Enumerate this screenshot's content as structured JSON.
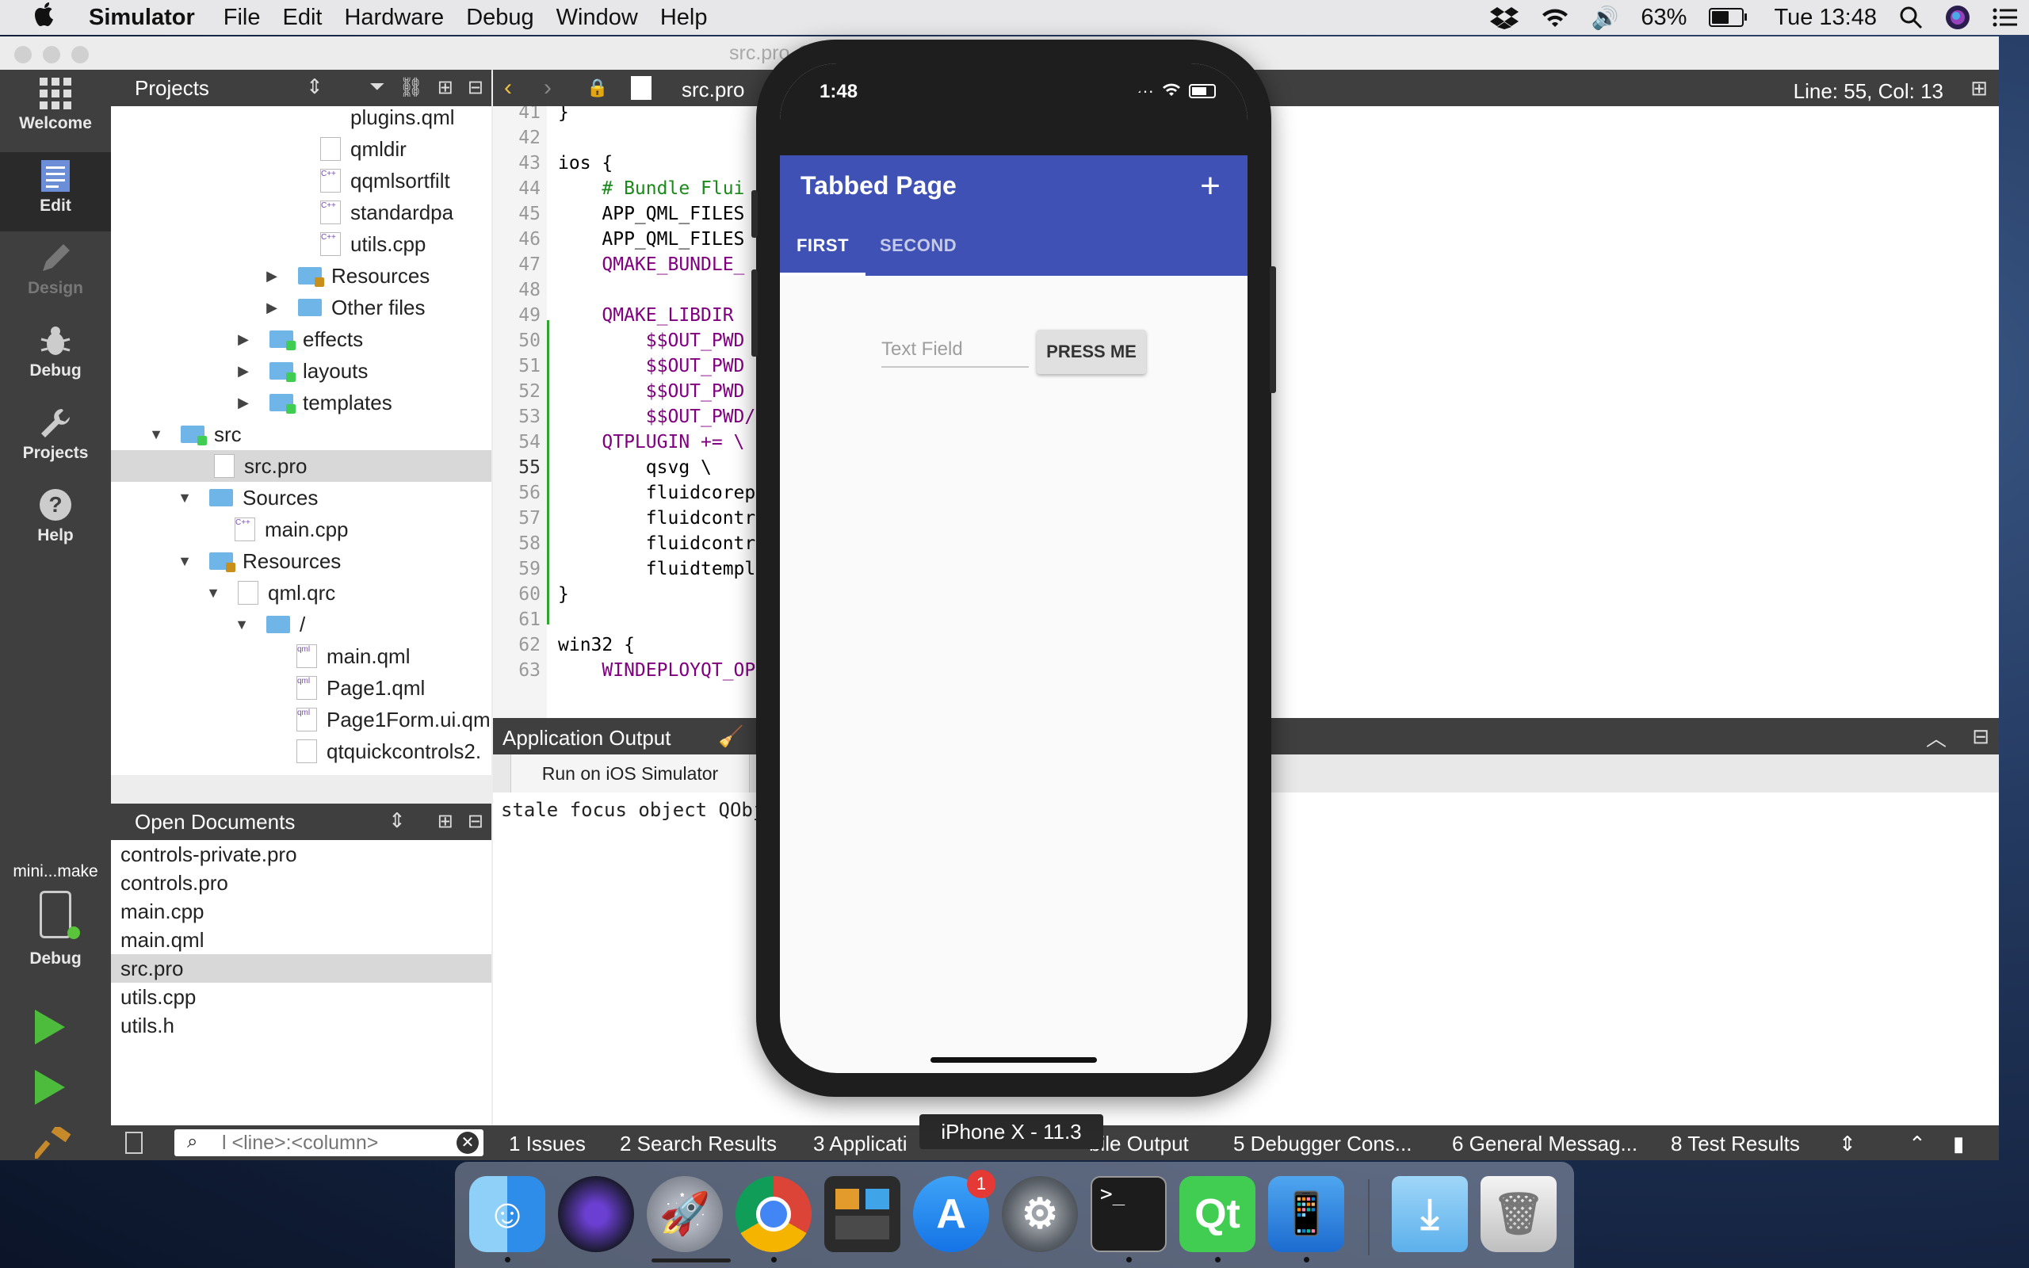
{
  "menubar": {
    "app_name": "Simulator",
    "menus": [
      "File",
      "Edit",
      "Hardware",
      "Debug",
      "Window",
      "Help"
    ],
    "battery_percent": "63%",
    "clock": "Tue 13:48",
    "battery_level": 0.63
  },
  "window": {
    "title": "src.pro @ controls - Qt Creator"
  },
  "modes": [
    {
      "label": "Welcome",
      "icon": "grid-icon"
    },
    {
      "label": "Edit",
      "icon": "document-icon"
    },
    {
      "label": "Design",
      "icon": "pencil-icon"
    },
    {
      "label": "Debug",
      "icon": "bug-icon"
    },
    {
      "label": "Projects",
      "icon": "wrench-icon"
    },
    {
      "label": "Help",
      "icon": "help-icon"
    }
  ],
  "kit": {
    "name": "mini...make",
    "mode": "Debug"
  },
  "projects": {
    "title": "Projects",
    "tree": [
      "plugins.qml",
      "qmldir",
      "qqmlsortfilt",
      "standardpa",
      "utils.cpp",
      "Resources",
      "Other files",
      "effects",
      "layouts",
      "templates",
      "src",
      "src.pro",
      "Sources",
      "main.cpp",
      "Resources",
      "qml.qrc",
      "/",
      "main.qml",
      "Page1.qml",
      "Page1Form.ui.qm",
      "qtquickcontrols2."
    ]
  },
  "open_documents": {
    "title": "Open Documents",
    "items": [
      "controls-private.pro",
      "controls.pro",
      "main.cpp",
      "main.qml",
      "src.pro",
      "utils.cpp",
      "utils.h"
    ]
  },
  "editor": {
    "filename": "src.pro",
    "cursor": "Line: 55, Col: 13",
    "line_numbers": [
      "41",
      "42",
      "43",
      "44",
      "45",
      "46",
      "47",
      "48",
      "49",
      "50",
      "51",
      "52",
      "53",
      "54",
      "55",
      "56",
      "57",
      "58",
      "59",
      "60",
      "61",
      "62",
      "63"
    ],
    "lines": [
      "}",
      "",
      "ios {",
      "    # Bundle Flui",
      "    APP_QML_FILES",
      "    APP_QML_FILES",
      "    QMAKE_BUNDLE_",
      "",
      "    QMAKE_LIBDIR ",
      "        $$OUT_PWD",
      "        $$OUT_PWD",
      "        $$OUT_PWD",
      "        $$OUT_PWD/",
      "    QTPLUGIN += \\",
      "        qsvg \\",
      "        fluidcorep",
      "        fluidcontr",
      "        fluidcontr",
      "        fluidtempl",
      "}",
      "",
      "win32 {",
      "    WINDEPLOYQT_OP"
    ]
  },
  "output": {
    "title": "Application Output",
    "tab": "Run on iOS Simulator",
    "text": "stale focus object QObj"
  },
  "statusbar": {
    "locator_placeholder": "l <line>:<column>",
    "panes": [
      "1  Issues",
      "2  Search Results",
      "3  Applicati",
      "bile Output",
      "5  Debugger Cons...",
      "6  General Messag...",
      "8  Test Results"
    ]
  },
  "tooltip": "iPhone X - 11.3",
  "simulator": {
    "time": "1:48",
    "app_title": "Tabbed Page",
    "add_symbol": "+",
    "tabs": [
      "FIRST",
      "SECOND"
    ],
    "text_field_placeholder": "Text Field",
    "button_label": "PRESS ME"
  },
  "dock": {
    "apps": [
      "Finder",
      "Siri",
      "Launchpad",
      "Chrome",
      "Activity Monitor",
      "App Store",
      "System Preferences",
      "Terminal",
      "Qt Creator",
      "Xcode Simulator",
      "Downloads",
      "Trash"
    ],
    "app_store_badge": "1"
  },
  "colors": {
    "app_bar": "#3f51b5",
    "qt_sidebar": "#3f3f3f",
    "run_green": "#4dbb3c"
  }
}
